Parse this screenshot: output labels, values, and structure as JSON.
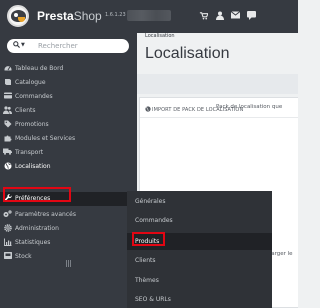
{
  "header": {
    "brand_main": "Presta",
    "brand_suffix": "Shop",
    "version": "1.6.1.23",
    "icons": [
      "shopping-cart-icon",
      "user-icon",
      "envelope-icon",
      "comment-icon"
    ]
  },
  "sidebar": {
    "search": {
      "placeholder": "Rechercher"
    },
    "items": [
      {
        "label": "Tableau de Bord",
        "icon": "speedometer-icon"
      },
      {
        "label": "Catalogue",
        "icon": "book-icon"
      },
      {
        "label": "Commandes",
        "icon": "credit-card-icon"
      },
      {
        "label": "Clients",
        "icon": "users-icon"
      },
      {
        "label": "Promotions",
        "icon": "tag-icon"
      },
      {
        "label": "Modules et Services",
        "icon": "puzzle-icon"
      },
      {
        "label": "Transport",
        "icon": "truck-icon"
      },
      {
        "label": "Localisation",
        "icon": "globe-icon"
      },
      {
        "label": "Préférences",
        "icon": "wrench-icon"
      },
      {
        "label": "Paramètres avancés",
        "icon": "cogs-icon"
      },
      {
        "label": "Administration",
        "icon": "gear-icon"
      },
      {
        "label": "Statistiques",
        "icon": "bar-chart-icon"
      },
      {
        "label": "Stock",
        "icon": "inbox-icon"
      }
    ]
  },
  "main": {
    "breadcrumb": "Localisation",
    "title": "Localisation",
    "panel": {
      "heading": "IMPORT DE PACK DE LOCALISATION",
      "pack_label": "Pack de localisation que",
      "download_label": "Télécharger le"
    }
  },
  "submenu": {
    "items": [
      {
        "label": "Générales"
      },
      {
        "label": "Commandes"
      },
      {
        "label": "Produits"
      },
      {
        "label": "Clients"
      },
      {
        "label": "Thèmes"
      },
      {
        "label": "SEO & URLs"
      }
    ]
  },
  "colors": {
    "sidebar_bg": "#363a41",
    "submenu_bg": "#2f3237",
    "active_bg": "#202226",
    "highlight": "#e20613",
    "page_bg": "#eff1f2"
  }
}
